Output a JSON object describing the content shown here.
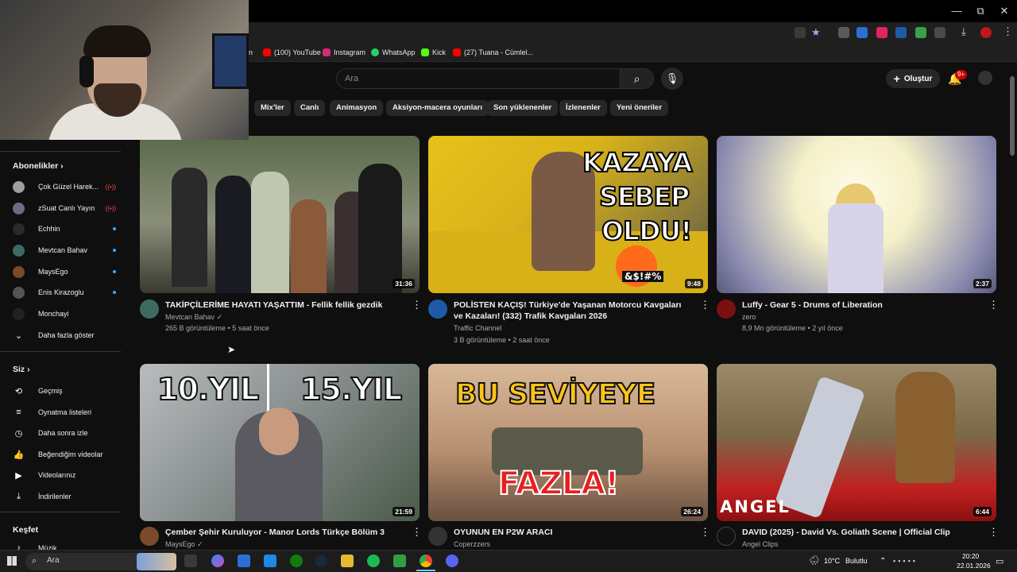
{
  "window": {
    "min": "—",
    "max": "⧉",
    "close": "✕"
  },
  "bookmarks": [
    {
      "label": "n",
      "color": "#777"
    },
    {
      "label": "(100) YouTube",
      "color": "#ff0000"
    },
    {
      "label": "Instagram",
      "color": "#d62976"
    },
    {
      "label": "WhatsApp",
      "color": "#25d366"
    },
    {
      "label": "Kick",
      "color": "#53fc18"
    },
    {
      "label": "(27) Tuana - Cümlel...",
      "color": "#ff0000"
    }
  ],
  "header": {
    "search_placeholder": "Ara",
    "create_label": "Oluştur",
    "notif_count": "9+"
  },
  "chips": [
    "Mix'ler",
    "Canlı",
    "Animasyon",
    "Aksiyon-macera oyunları",
    "Son yüklenenler",
    "İzlenenler",
    "Yeni öneriler"
  ],
  "sidebar": {
    "subs_title": "Abonelikler",
    "subs": [
      {
        "label": "Çok Güzel Harek...",
        "status": "live",
        "color": "#9e9e9e"
      },
      {
        "label": "zSuat Canlı Yayın",
        "status": "live",
        "color": "#6b6b8a"
      },
      {
        "label": "Echhin",
        "status": "dot",
        "color": "#2a2a2a"
      },
      {
        "label": "Mevtcan Bahav",
        "status": "dot",
        "color": "#3d6b63"
      },
      {
        "label": "MaysEgo",
        "status": "dot",
        "color": "#7a4a2a"
      },
      {
        "label": "Enis Kirazoglu",
        "status": "dot",
        "color": "#555"
      },
      {
        "label": "Monchayi",
        "status": "",
        "color": "#222"
      }
    ],
    "show_more": "Daha fazla göster",
    "you_title": "Siz",
    "you_items": [
      {
        "label": "Geçmiş",
        "icon": "history-icon",
        "glyph": "⟲"
      },
      {
        "label": "Oynatma listeleri",
        "icon": "playlist-icon",
        "glyph": "≡"
      },
      {
        "label": "Daha sonra izle",
        "icon": "clock-icon",
        "glyph": "◷"
      },
      {
        "label": "Beğendiğim videolar",
        "icon": "thumbs-up-icon",
        "glyph": "👍"
      },
      {
        "label": "Videolarınız",
        "icon": "video-icon",
        "glyph": "▶"
      },
      {
        "label": "İndirilenler",
        "icon": "download-icon",
        "glyph": "⤓"
      }
    ],
    "explore_title": "Keşfet",
    "explore_items": [
      {
        "label": "Müzik",
        "icon": "music-icon",
        "glyph": "♪"
      }
    ]
  },
  "videos": [
    {
      "title": "TAKİPÇİLERİME HAYATI YAŞATTIM - Fellik fellik gezdik",
      "channel": "Mevtcan Bahav",
      "verified": "✓",
      "stats": "265 B görüntüleme • 5 saat önce",
      "duration": "31:36",
      "thumb": [
        "#4a5a3a",
        "#8a8f7a"
      ],
      "avatar": "#3d6b63"
    },
    {
      "title": "POLİSTEN KAÇIŞ! Türkiye'de Yaşanan Motorcu Kavgaları ve Kazaları! (332) Trafik Kavgaları 2026",
      "channel": "Traffic Channel",
      "verified": "",
      "stats": "3 B görüntüleme • 2 saat önce",
      "duration": "9:48",
      "thumb": [
        "#d9b21a",
        "#6a5a2a"
      ],
      "avatar": "#1e5aa8"
    },
    {
      "title": "Luffy - Gear 5 - Drums of Liberation",
      "channel": "zero",
      "verified": "",
      "stats": "8,9 Mn görüntüleme • 2 yıl önce",
      "duration": "2:37",
      "thumb": [
        "#f4f0d8",
        "#7a7aa0"
      ],
      "avatar": "#7a1010"
    },
    {
      "title": "Çember Şehir Kuruluyor - Manor Lords Türkçe Bölüm 3",
      "channel": "MaysEgo",
      "verified": "✓",
      "stats": "",
      "duration": "21:59",
      "thumb": [
        "#9aa0a0",
        "#3a4a3a"
      ],
      "avatar": "#7a4a2a"
    },
    {
      "title": "OYUNUN EN P2W ARACI",
      "channel": "Coperzzers",
      "verified": "",
      "stats": "",
      "duration": "26:24",
      "thumb": [
        "#c8a078",
        "#6a5040"
      ],
      "avatar": "#333"
    },
    {
      "title": "DAVID (2025) - David Vs. Goliath Scene | Official Clip",
      "channel": "Angel Clips",
      "verified": "",
      "stats": "",
      "duration": "6:44",
      "thumb": [
        "#8a7a5a",
        "#c02020"
      ],
      "avatar": "#111"
    }
  ],
  "overlays": {
    "kazaya": "KAZAYA",
    "sebep": "SEBEP",
    "oldu": "OLDU!",
    "censor": "&$!#%",
    "yil10": "10.YIL",
    "yil15": "15.YIL",
    "buseviyeye": "BU SEVİYEYE",
    "fazla": "FAZLA!",
    "angel": "ANGEL"
  },
  "taskbar": {
    "search": "Ara",
    "weather_temp": "10°C",
    "weather_desc": "Bulutlu",
    "time": "20:20",
    "date": "22.01.2026"
  }
}
